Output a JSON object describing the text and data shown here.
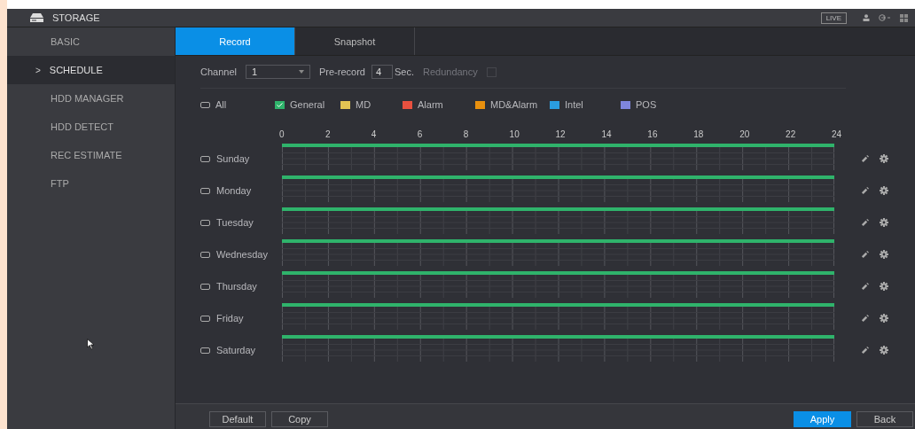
{
  "header": {
    "title": "STORAGE",
    "live": "LIVE"
  },
  "sidebar": {
    "items": [
      {
        "label": "BASIC",
        "selected": false
      },
      {
        "label": "SCHEDULE",
        "selected": true,
        "marker": ">"
      },
      {
        "label": "HDD MANAGER",
        "selected": false
      },
      {
        "label": "HDD DETECT",
        "selected": false
      },
      {
        "label": "REC ESTIMATE",
        "selected": false
      },
      {
        "label": "FTP",
        "selected": false
      }
    ]
  },
  "tabs": [
    {
      "label": "Record",
      "selected": true
    },
    {
      "label": "Snapshot",
      "selected": false
    }
  ],
  "settings": {
    "channel_label": "Channel",
    "channel_value": "1",
    "prerecord_label": "Pre-record",
    "prerecord_value": "4",
    "prerecord_unit": "Sec.",
    "redundancy_label": "Redundancy",
    "redundancy_disabled": true,
    "redundancy_checked": false
  },
  "legend": [
    {
      "kind": "all",
      "label": "All",
      "checked": false
    },
    {
      "kind": "type",
      "label": "General",
      "checked": true,
      "color": "#2fb36b"
    },
    {
      "kind": "type",
      "label": "MD",
      "checked": false,
      "color": "#e2c453"
    },
    {
      "kind": "type",
      "label": "Alarm",
      "checked": false,
      "color": "#e8503f"
    },
    {
      "kind": "type",
      "label": "MD&Alarm",
      "checked": false,
      "color": "#e8900e"
    },
    {
      "kind": "type",
      "label": "Intel",
      "checked": false,
      "color": "#2a9de0"
    },
    {
      "kind": "type",
      "label": "POS",
      "checked": false,
      "color": "#7f86dc"
    }
  ],
  "hours": [
    "0",
    "2",
    "4",
    "6",
    "8",
    "10",
    "12",
    "14",
    "16",
    "18",
    "20",
    "22",
    "24"
  ],
  "days": [
    {
      "label": "Sunday",
      "checked": false,
      "level": 1
    },
    {
      "label": "Monday",
      "checked": false,
      "level": 1
    },
    {
      "label": "Tuesday",
      "checked": false,
      "level": 1
    },
    {
      "label": "Wednesday",
      "checked": false,
      "level": 1
    },
    {
      "label": "Thursday",
      "checked": false,
      "level": 1
    },
    {
      "label": "Friday",
      "checked": false,
      "level": 1
    },
    {
      "label": "Saturday",
      "checked": false,
      "level": 1
    }
  ],
  "footer": {
    "left": [
      "Default",
      "Copy"
    ],
    "apply": "Apply",
    "back": "Back"
  }
}
